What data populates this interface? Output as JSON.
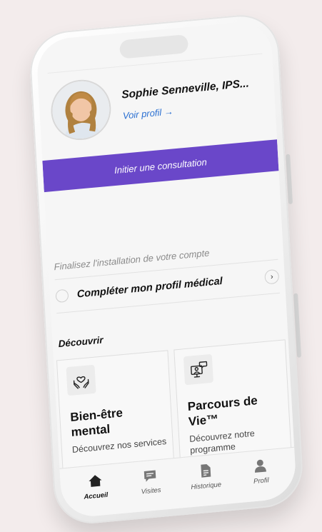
{
  "profile": {
    "name": "Sophie Senneville, IPS...",
    "link": "Voir profil →"
  },
  "cta": {
    "label": "Initier une consultation"
  },
  "setup": {
    "title": "Finalisez l'installation de votre compte",
    "task_label": "Compléter mon profil médical",
    "chevron": "›"
  },
  "discover": {
    "title": "Découvrir",
    "cards": [
      {
        "title": "Bien-être mental",
        "desc": "Découvrez nos services",
        "icon": "hands-heart-icon"
      },
      {
        "title": "Parcours de Vie™",
        "desc": "Découvrez notre programme",
        "icon": "video-consult-icon"
      }
    ]
  },
  "tabs": [
    {
      "label": "Accueil",
      "icon": "home-icon",
      "active": true
    },
    {
      "label": "Visites",
      "icon": "chat-icon",
      "active": false
    },
    {
      "label": "Historique",
      "icon": "document-icon",
      "active": false
    },
    {
      "label": "Profil",
      "icon": "person-icon",
      "active": false
    }
  ],
  "colors": {
    "accent": "#6a47c9",
    "link": "#2a6fd1",
    "background": "#f3ecec"
  }
}
